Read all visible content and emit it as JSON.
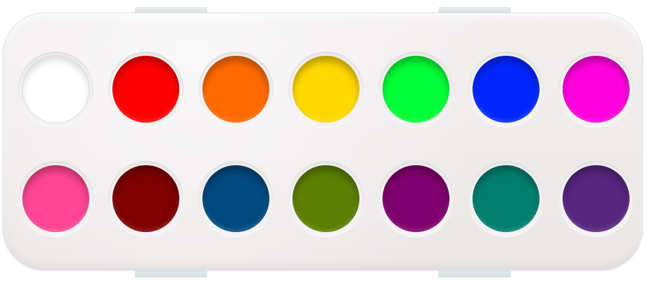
{
  "palette": {
    "wells": [
      {
        "name": "white",
        "color": "#ffffff"
      },
      {
        "name": "red",
        "color": "#ff0000"
      },
      {
        "name": "orange",
        "color": "#ff6a00"
      },
      {
        "name": "yellow",
        "color": "#ffd800"
      },
      {
        "name": "green",
        "color": "#00ff36"
      },
      {
        "name": "blue",
        "color": "#0026ff"
      },
      {
        "name": "magenta",
        "color": "#ff00dc"
      },
      {
        "name": "pink",
        "color": "#ff4592"
      },
      {
        "name": "maroon",
        "color": "#7f0000"
      },
      {
        "name": "navy-blue",
        "color": "#004a7f"
      },
      {
        "name": "olive-green",
        "color": "#5b7f00"
      },
      {
        "name": "purple",
        "color": "#7f006e"
      },
      {
        "name": "teal",
        "color": "#007f6e"
      },
      {
        "name": "violet",
        "color": "#57267f"
      }
    ]
  }
}
